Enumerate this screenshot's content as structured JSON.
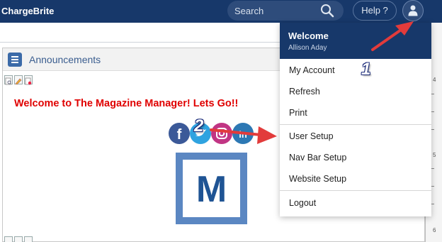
{
  "header": {
    "brand": "ChargeBrite",
    "search_placeholder": "Search",
    "help_label": "Help ?"
  },
  "panel": {
    "title": "Announcements",
    "welcome_message": "Welcome to The Magazine Manager!  Lets Go!!",
    "logo_letter": "M",
    "social_icons": [
      "facebook-icon",
      "twitter-icon",
      "instagram-icon",
      "linkedin-icon"
    ]
  },
  "ruler": {
    "numbers": [
      "4",
      "5",
      "6"
    ]
  },
  "user_menu": {
    "welcome": "Welcome",
    "user_name": "Allison Aday",
    "items": [
      {
        "label": "My Account"
      },
      {
        "label": "Refresh"
      },
      {
        "label": "Print"
      },
      {
        "label": "User Setup"
      },
      {
        "label": "Nav Bar Setup"
      },
      {
        "label": "Website Setup"
      },
      {
        "label": "Logout"
      }
    ]
  },
  "annotations": {
    "step1": "1",
    "step2": "2",
    "arrow_color": "#e23b3b"
  },
  "colors": {
    "nav_bg": "#17386a",
    "accent_blue": "#3b6aa8",
    "welcome_red": "#e00000"
  }
}
